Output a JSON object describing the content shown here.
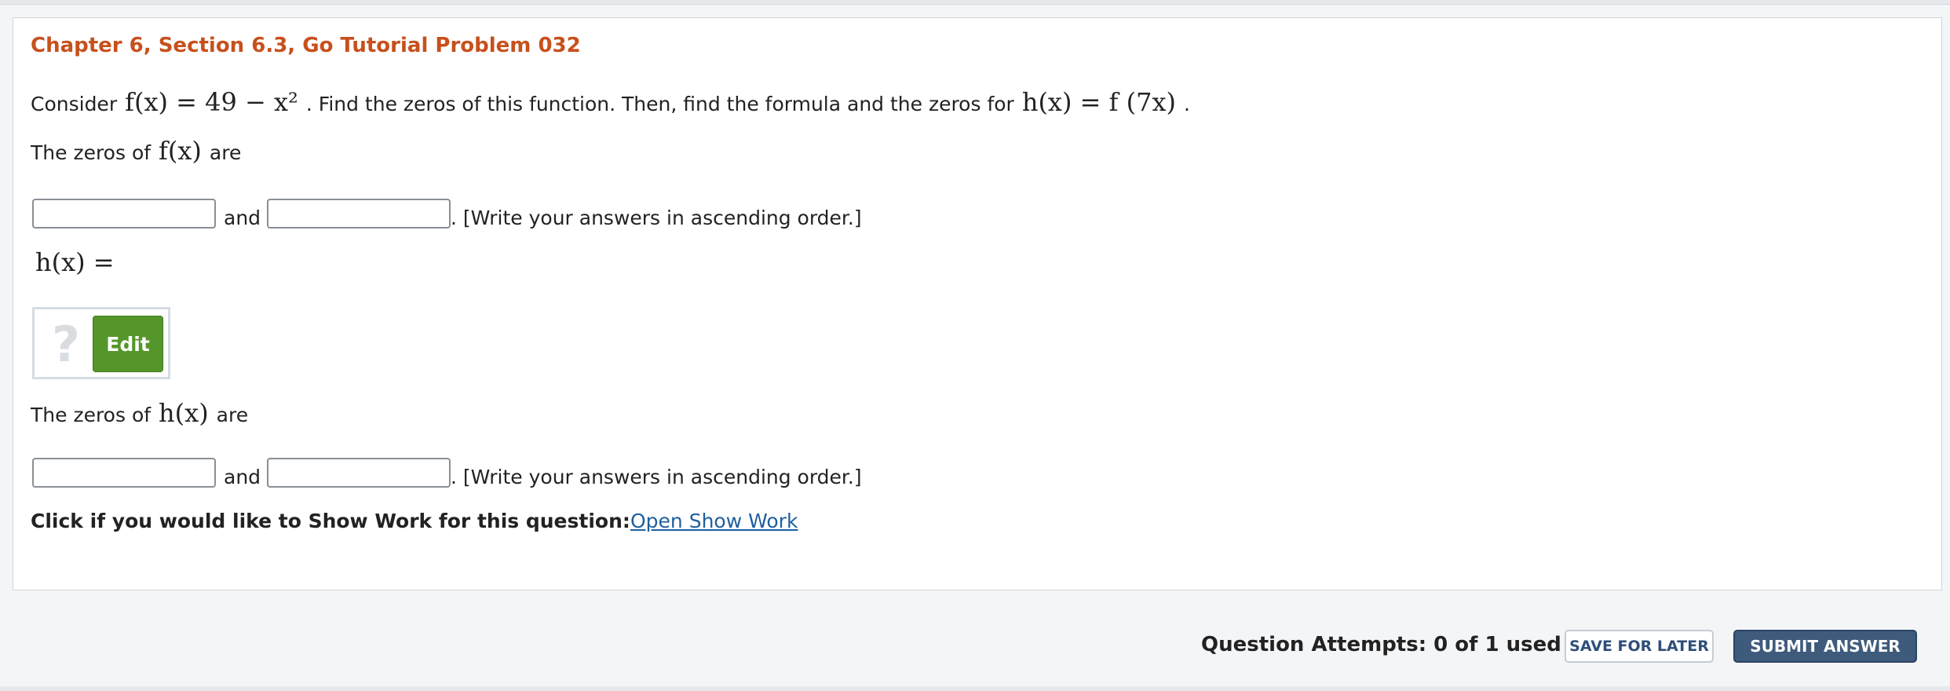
{
  "problem": {
    "title": "Chapter 6, Section 6.3, Go Tutorial Problem 032",
    "intro_prefix": "Consider",
    "f_def": "f(x) = 49 − x²",
    "intro_middle": ". Find the zeros of this function. Then, find the formula and the zeros for",
    "h_def": "h(x) = f (7x)",
    "intro_suffix": ".",
    "zeros_f_prefix": "The zeros of",
    "f_symbol": "f(x)",
    "zeros_suffix": "are",
    "and_label": "and",
    "order_hint": ". [Write your answers in ascending order.]",
    "h_equals": "h(x) =",
    "zeros_h_prefix": "The zeros of",
    "h_symbol": "h(x)"
  },
  "answers": {
    "f_zero_1": "",
    "f_zero_2": "",
    "h_zero_1": "",
    "h_zero_2": ""
  },
  "editor": {
    "placeholder_glyph": "?",
    "edit_label": "Edit"
  },
  "show_work": {
    "prompt": "Click if you would like to Show Work for this question:",
    "link": "Open Show Work"
  },
  "footer": {
    "attempts": "Question Attempts: 0 of 1 used",
    "save_label": "SAVE FOR LATER",
    "submit_label": "SUBMIT ANSWER"
  },
  "colors": {
    "title": "#c7501c",
    "edit_button": "#55962b",
    "submit_button": "#3e5b7c",
    "link": "#1f5fa0"
  }
}
